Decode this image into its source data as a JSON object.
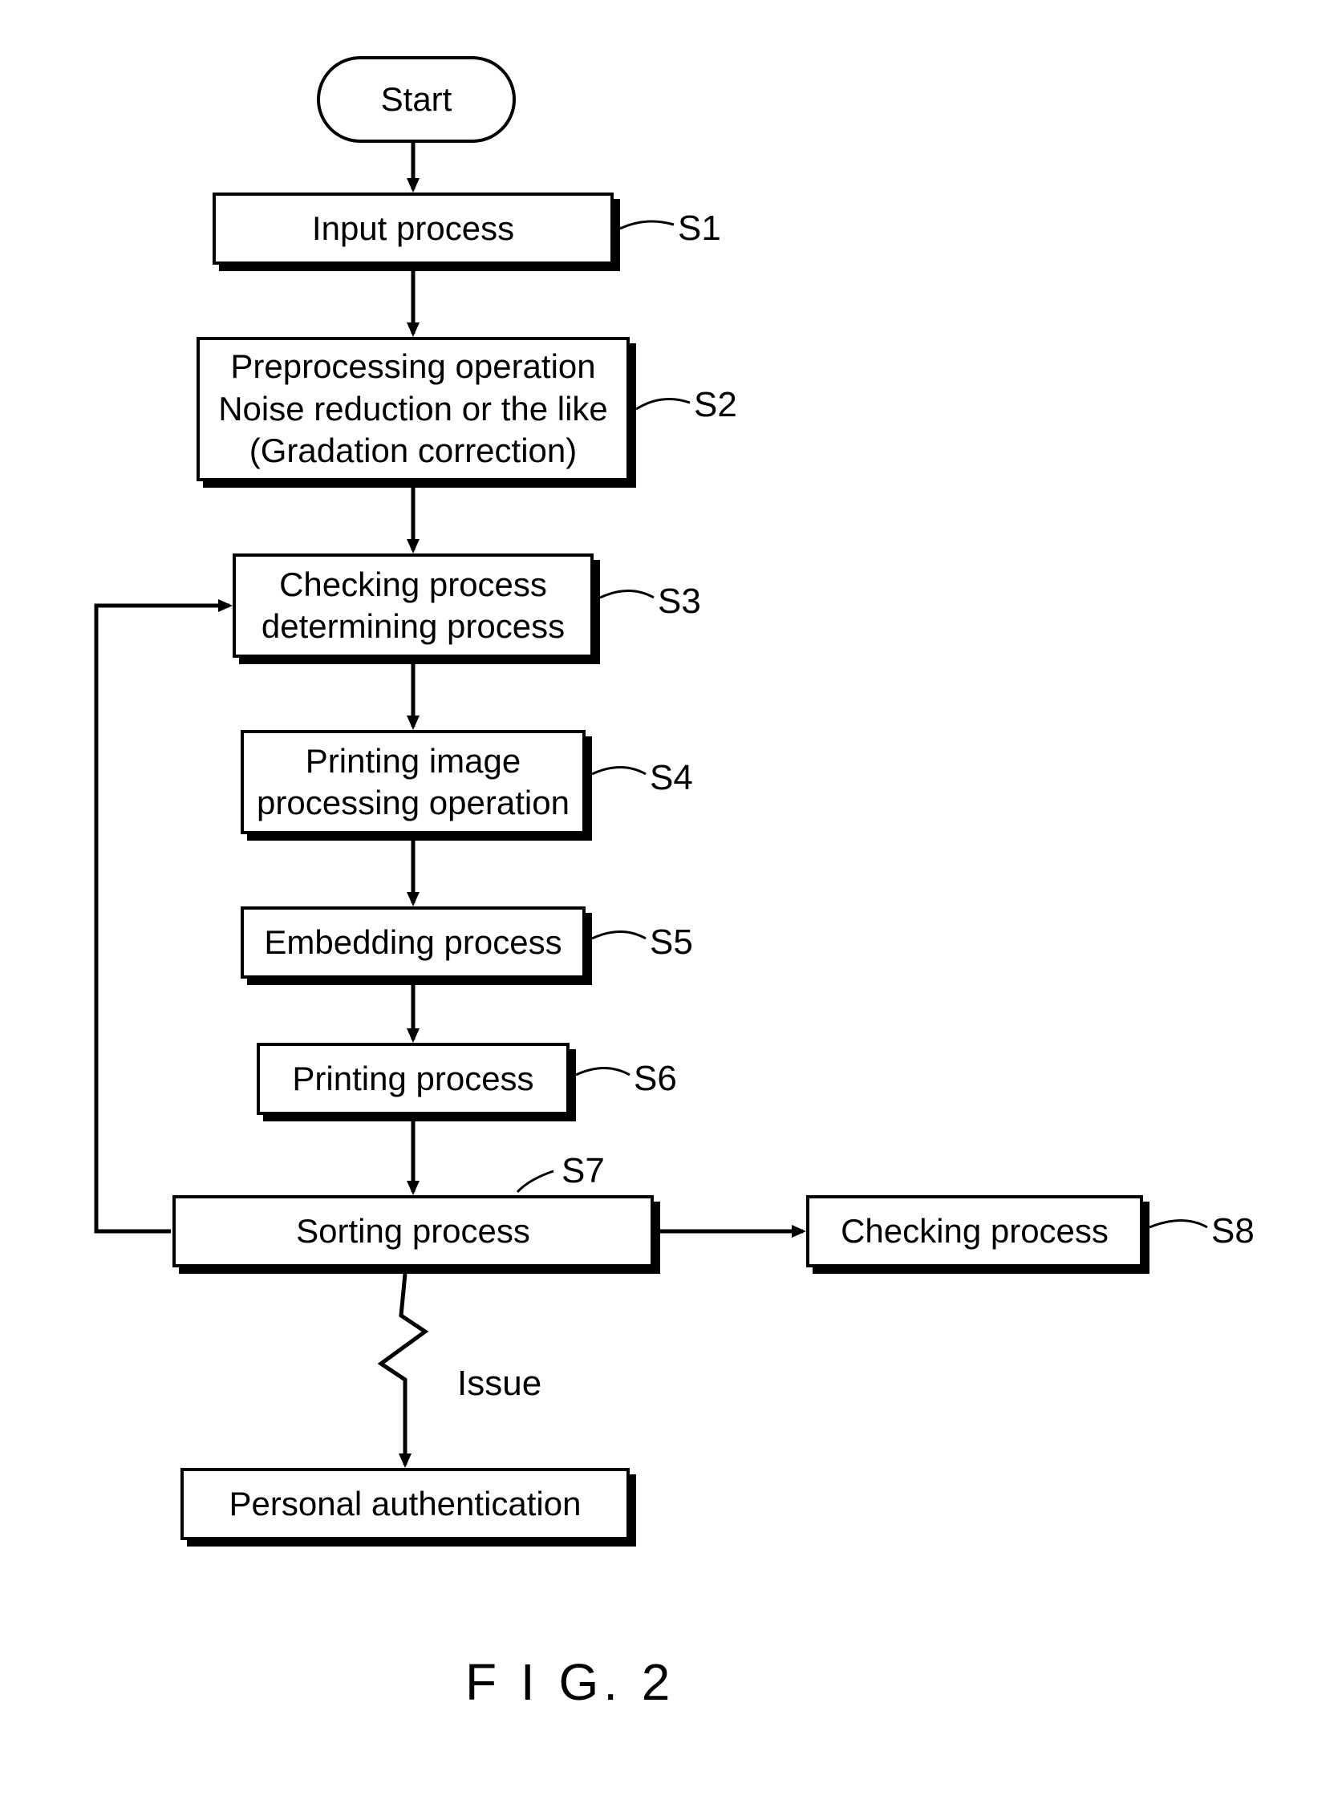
{
  "chart_data": {
    "type": "flowchart",
    "title": "FIG. 2",
    "nodes": [
      {
        "id": "start",
        "kind": "terminator",
        "label": "Start"
      },
      {
        "id": "S1",
        "kind": "process",
        "label": "Input process",
        "tag": "S1"
      },
      {
        "id": "S2",
        "kind": "process",
        "label": "Preprocessing operation\nNoise reduction or the like\n(Gradation correction)",
        "tag": "S2"
      },
      {
        "id": "S3",
        "kind": "process",
        "label": "Checking process\ndetermining process",
        "tag": "S3"
      },
      {
        "id": "S4",
        "kind": "process",
        "label": "Printing image\nprocessing operation",
        "tag": "S4"
      },
      {
        "id": "S5",
        "kind": "process",
        "label": "Embedding process",
        "tag": "S5"
      },
      {
        "id": "S6",
        "kind": "process",
        "label": "Printing process",
        "tag": "S6"
      },
      {
        "id": "S7",
        "kind": "process",
        "label": "Sorting process",
        "tag": "S7"
      },
      {
        "id": "S8",
        "kind": "process",
        "label": "Checking process",
        "tag": "S8"
      },
      {
        "id": "PA",
        "kind": "process",
        "label": "Personal authentication"
      }
    ],
    "edges": [
      {
        "from": "start",
        "to": "S1"
      },
      {
        "from": "S1",
        "to": "S2"
      },
      {
        "from": "S2",
        "to": "S3"
      },
      {
        "from": "S3",
        "to": "S4"
      },
      {
        "from": "S4",
        "to": "S5"
      },
      {
        "from": "S5",
        "to": "S6"
      },
      {
        "from": "S6",
        "to": "S7"
      },
      {
        "from": "S7",
        "to": "S8"
      },
      {
        "from": "S7",
        "to": "PA",
        "label": "Issue",
        "style": "zigzag"
      },
      {
        "from": "S8",
        "to": "S3",
        "style": "back-loop"
      }
    ]
  },
  "nodes": {
    "start": "Start",
    "s1": "Input process",
    "s2": "Preprocessing operation\nNoise reduction or the like\n(Gradation correction)",
    "s3": "Checking process\ndetermining process",
    "s4": "Printing image\nprocessing operation",
    "s5": "Embedding process",
    "s6": "Printing process",
    "s7": "Sorting process",
    "s8": "Checking process",
    "pa": "Personal authentication"
  },
  "tags": {
    "s1": "S1",
    "s2": "S2",
    "s3": "S3",
    "s4": "S4",
    "s5": "S5",
    "s6": "S6",
    "s7": "S7",
    "s8": "S8"
  },
  "edge_labels": {
    "issue": "Issue"
  },
  "caption": "F I G. 2"
}
